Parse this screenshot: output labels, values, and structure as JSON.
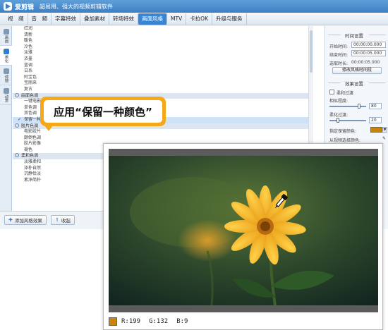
{
  "app": {
    "name": "爱剪辑",
    "slogan": "超易用、强大的视频剪辑软件"
  },
  "tabs": [
    {
      "label": "视　频",
      "active": false
    },
    {
      "label": "音　频",
      "active": false
    },
    {
      "label": "字幕特效",
      "active": false
    },
    {
      "label": "叠加素材",
      "active": false
    },
    {
      "label": "转场特效",
      "active": false
    },
    {
      "label": "画面风格",
      "active": true
    },
    {
      "label": "MTV",
      "active": false
    },
    {
      "label": "卡拉OK",
      "active": false
    },
    {
      "label": "升级与服务",
      "active": false
    }
  ],
  "rail": [
    {
      "label": "画面",
      "active": false
    },
    {
      "label": "美化",
      "active": true
    },
    {
      "label": "滤镜",
      "active": false
    },
    {
      "label": "动景",
      "active": false
    }
  ],
  "effect_list": [
    {
      "label": "红润",
      "type": "item"
    },
    {
      "label": "清新",
      "type": "item"
    },
    {
      "label": "暖色",
      "type": "item"
    },
    {
      "label": "冷色",
      "type": "item"
    },
    {
      "label": "淡雅",
      "type": "item"
    },
    {
      "label": "浓墨",
      "type": "item"
    },
    {
      "label": "蓝调",
      "type": "item"
    },
    {
      "label": "日系",
      "type": "item"
    },
    {
      "label": "阿宝色",
      "type": "item"
    },
    {
      "label": "宝丽来",
      "type": "item"
    },
    {
      "label": "复古",
      "type": "item"
    },
    {
      "label": "画面色调",
      "type": "category"
    },
    {
      "label": "一键电影",
      "type": "item"
    },
    {
      "label": "单色调",
      "type": "item"
    },
    {
      "label": "双色调",
      "type": "item"
    },
    {
      "label": "保留一种颜色",
      "type": "item",
      "selected": true
    },
    {
      "label": "胶片色调",
      "type": "category"
    },
    {
      "label": "电影胶片",
      "type": "item"
    },
    {
      "label": "颠倒色调",
      "type": "item"
    },
    {
      "label": "胶片影像",
      "type": "item"
    },
    {
      "label": "褪色",
      "type": "item"
    },
    {
      "label": "柔和色调",
      "type": "category"
    },
    {
      "label": "淡雅柔和",
      "type": "item"
    },
    {
      "label": "泽朴自然",
      "type": "item"
    },
    {
      "label": "沉静恰淡",
      "type": "item"
    },
    {
      "label": "素净简朴",
      "type": "item"
    }
  ],
  "bottom_buttons": {
    "add": "添加风格效果",
    "collapse": "收起"
  },
  "panel": {
    "time_section": "时间设置",
    "start_label": "开始时间:",
    "start_value": "00:00:00.000",
    "end_label": "结束时间:",
    "end_value": "00:00:05.000",
    "duration_label": "选取时长:",
    "duration_value": "00:00:05.000",
    "modify_button": "修改风格时间段",
    "effect_section": "效果设置",
    "soft_transition": "柔和过渡",
    "similarity_label": "相似程度:",
    "similarity_value": "80",
    "softness_label": "柔化过渡:",
    "softness_value": "20",
    "keep_color_label": "指定保留颜色:",
    "keep_color_hex": "#c78409",
    "pick_from_video": "从视频选择颜色:"
  },
  "callout": {
    "text": "应用“保留一种颜色”"
  },
  "readout": {
    "r": "R:199",
    "g": "G:132",
    "b": "B:9",
    "swatch_hex": "#c78409"
  }
}
